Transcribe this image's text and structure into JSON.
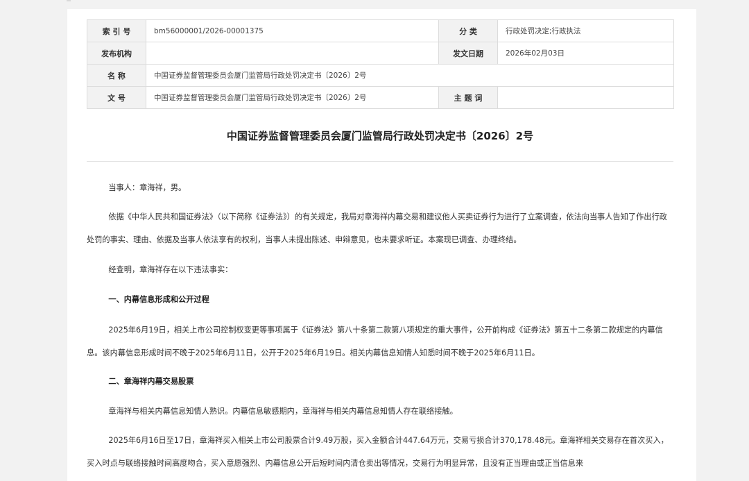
{
  "meta": {
    "index_label": "索 引 号",
    "index_value": "bm56000001/2026-00001375",
    "category_label": "分 类",
    "category_value": "行政处罚决定;行政执法",
    "publisher_label": "发布机构",
    "publisher_value": "",
    "date_label": "发文日期",
    "date_value": "2026年02月03日",
    "name_label": "名 称",
    "name_value": "中国证券监督管理委员会厦门监管局行政处罚决定书〔2026〕2号",
    "docno_label": "文 号",
    "docno_value": "中国证券监督管理委员会厦门监管局行政处罚决定书〔2026〕2号",
    "keywords_label": "主 题 词",
    "keywords_value": ""
  },
  "document": {
    "title": "中国证券监督管理委员会厦门监管局行政处罚决定书〔2026〕2号",
    "paragraphs": [
      "当事人：章海祥，男。",
      "依据《中华人民共和国证券法》（以下简称《证券法》）的有关规定，我局对章海祥内幕交易和建议他人买卖证券行为进行了立案调查，依法向当事人告知了作出行政处罚的事实、理由、依据及当事人依法享有的权利，当事人未提出陈述、申辩意见，也未要求听证。本案现已调查、办理终结。",
      "经查明，章海祥存在以下违法事实：",
      "一、内幕信息形成和公开过程",
      "2025年6月19日，相关上市公司控制权变更等事项属于《证券法》第八十条第二款第八项规定的重大事件，公开前构成《证券法》第五十二条第二款规定的内幕信息。该内幕信息形成时间不晚于2025年6月11日，公开于2025年6月19日。相关内幕信息知情人知悉时间不晚于2025年6月11日。",
      "二、章海祥内幕交易股票",
      "章海祥与相关内幕信息知情人熟识。内幕信息敏感期内，章海祥与相关内幕信息知情人存在联络接触。",
      "2025年6月16日至17日，章海祥买入相关上市公司股票合计9.49万股，买入金额合计447.64万元，交易亏损合计370,178.48元。章海祥相关交易存在首次买入，买入时点与联络接触时间高度吻合，买入意愿强烈、内幕信息公开后短时间内清仓卖出等情况，交易行为明显异常，且没有正当理由或正当信息来"
    ]
  }
}
